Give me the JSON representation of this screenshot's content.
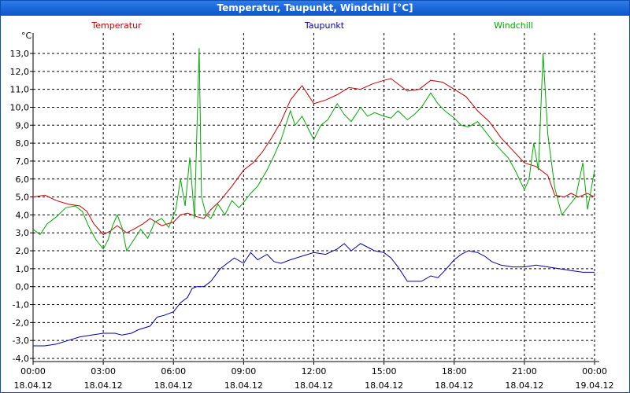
{
  "window": {
    "title": "Temperatur, Taupunkt, Windchill [°C]"
  },
  "chart_data": {
    "type": "line",
    "title": "Temperatur, Taupunkt, Windchill [°C]",
    "ylabel": "°C",
    "ylim": [
      -4.0,
      14.0
    ],
    "yticks": [
      "13,0",
      "12,0",
      "11,0",
      "10,0",
      "9,0",
      "8,0",
      "7,0",
      "6,0",
      "5,0",
      "4,0",
      "3,0",
      "2,0",
      "1,0",
      "0,0",
      "-1,0",
      "-2,0",
      "-3,0",
      "-4,0"
    ],
    "ytick_values": [
      13,
      12,
      11,
      10,
      9,
      8,
      7,
      6,
      5,
      4,
      3,
      2,
      1,
      0,
      -1,
      -2,
      -3,
      -4
    ],
    "xlim": [
      0,
      24
    ],
    "xticks": [
      {
        "time": "00:00",
        "date": "18.04.12",
        "hour": 0
      },
      {
        "time": "03:00",
        "date": "18.04.12",
        "hour": 3
      },
      {
        "time": "06:00",
        "date": "18.04.12",
        "hour": 6
      },
      {
        "time": "09:00",
        "date": "18.04.12",
        "hour": 9
      },
      {
        "time": "12:00",
        "date": "18.04.12",
        "hour": 12
      },
      {
        "time": "15:00",
        "date": "18.04.12",
        "hour": 15
      },
      {
        "time": "18:00",
        "date": "18.04.12",
        "hour": 18
      },
      {
        "time": "21:00",
        "date": "18.04.12",
        "hour": 21
      },
      {
        "time": "00:00",
        "date": "19.04.12",
        "hour": 24
      }
    ],
    "grid": true,
    "legend_position": "top",
    "series": [
      {
        "name": "Temperatur",
        "color": "#cc0000",
        "points": [
          [
            0,
            5.0
          ],
          [
            0.5,
            5.1
          ],
          [
            1,
            4.8
          ],
          [
            1.5,
            4.6
          ],
          [
            2,
            4.5
          ],
          [
            2.3,
            4.2
          ],
          [
            2.6,
            3.5
          ],
          [
            3,
            2.9
          ],
          [
            3.3,
            3.1
          ],
          [
            3.6,
            3.4
          ],
          [
            4,
            3.0
          ],
          [
            4.3,
            3.2
          ],
          [
            4.7,
            3.5
          ],
          [
            5,
            3.8
          ],
          [
            5.5,
            3.4
          ],
          [
            6,
            3.6
          ],
          [
            6.3,
            4.0
          ],
          [
            6.6,
            4.1
          ],
          [
            7,
            3.9
          ],
          [
            7.3,
            3.8
          ],
          [
            7.6,
            4.3
          ],
          [
            8,
            4.8
          ],
          [
            8.5,
            5.6
          ],
          [
            9,
            6.5
          ],
          [
            9.4,
            6.9
          ],
          [
            9.8,
            7.5
          ],
          [
            10.2,
            8.3
          ],
          [
            10.6,
            9.2
          ],
          [
            11,
            10.4
          ],
          [
            11.3,
            10.9
          ],
          [
            11.5,
            11.2
          ],
          [
            11.8,
            10.6
          ],
          [
            12,
            10.2
          ],
          [
            12.5,
            10.4
          ],
          [
            13,
            10.7
          ],
          [
            13.5,
            11.1
          ],
          [
            14,
            11.0
          ],
          [
            14.5,
            11.3
          ],
          [
            15,
            11.5
          ],
          [
            15.3,
            11.6
          ],
          [
            15.7,
            11.2
          ],
          [
            16,
            10.9
          ],
          [
            16.5,
            11.0
          ],
          [
            17,
            11.5
          ],
          [
            17.5,
            11.4
          ],
          [
            18,
            11.0
          ],
          [
            18.5,
            10.6
          ],
          [
            19,
            9.8
          ],
          [
            19.5,
            9.2
          ],
          [
            20,
            8.3
          ],
          [
            20.5,
            7.6
          ],
          [
            21,
            6.9
          ],
          [
            21.5,
            6.7
          ],
          [
            22,
            6.2
          ],
          [
            22.3,
            5.1
          ],
          [
            22.7,
            5.0
          ],
          [
            23,
            5.2
          ],
          [
            23.3,
            5.0
          ],
          [
            23.7,
            5.2
          ],
          [
            24,
            5.0
          ]
        ]
      },
      {
        "name": "Taupunkt",
        "color": "#0000aa",
        "points": [
          [
            0,
            -3.3
          ],
          [
            0.5,
            -3.3
          ],
          [
            1,
            -3.2
          ],
          [
            1.5,
            -3.0
          ],
          [
            2,
            -2.8
          ],
          [
            2.5,
            -2.7
          ],
          [
            3,
            -2.6
          ],
          [
            3.5,
            -2.6
          ],
          [
            3.8,
            -2.7
          ],
          [
            4.2,
            -2.6
          ],
          [
            4.5,
            -2.4
          ],
          [
            5,
            -2.2
          ],
          [
            5.3,
            -1.7
          ],
          [
            5.6,
            -1.6
          ],
          [
            6,
            -1.4
          ],
          [
            6.3,
            -0.9
          ],
          [
            6.6,
            -0.6
          ],
          [
            6.8,
            -0.1
          ],
          [
            7,
            0.0
          ],
          [
            7.3,
            0.0
          ],
          [
            7.6,
            0.3
          ],
          [
            8,
            1.0
          ],
          [
            8.3,
            1.3
          ],
          [
            8.6,
            1.6
          ],
          [
            9,
            1.3
          ],
          [
            9.3,
            1.9
          ],
          [
            9.6,
            1.5
          ],
          [
            10,
            1.8
          ],
          [
            10.3,
            1.4
          ],
          [
            10.6,
            1.3
          ],
          [
            11,
            1.5
          ],
          [
            11.5,
            1.7
          ],
          [
            12,
            1.9
          ],
          [
            12.5,
            1.8
          ],
          [
            13,
            2.1
          ],
          [
            13.3,
            2.4
          ],
          [
            13.6,
            2.0
          ],
          [
            14,
            2.4
          ],
          [
            14.3,
            2.2
          ],
          [
            14.6,
            2.0
          ],
          [
            15,
            1.9
          ],
          [
            15.3,
            1.6
          ],
          [
            15.6,
            1.1
          ],
          [
            16,
            0.3
          ],
          [
            16.3,
            0.3
          ],
          [
            16.6,
            0.3
          ],
          [
            17,
            0.6
          ],
          [
            17.3,
            0.5
          ],
          [
            17.6,
            0.9
          ],
          [
            18,
            1.5
          ],
          [
            18.3,
            1.8
          ],
          [
            18.6,
            2.0
          ],
          [
            19,
            1.9
          ],
          [
            19.3,
            1.7
          ],
          [
            19.6,
            1.4
          ],
          [
            20,
            1.2
          ],
          [
            20.5,
            1.1
          ],
          [
            21,
            1.1
          ],
          [
            21.5,
            1.2
          ],
          [
            22,
            1.1
          ],
          [
            22.5,
            1.0
          ],
          [
            23,
            0.9
          ],
          [
            23.5,
            0.8
          ],
          [
            24,
            0.8
          ]
        ]
      },
      {
        "name": "Windchill",
        "color": "#00aa00",
        "points": [
          [
            0,
            3.2
          ],
          [
            0.3,
            2.9
          ],
          [
            0.6,
            3.5
          ],
          [
            1,
            3.9
          ],
          [
            1.4,
            4.4
          ],
          [
            1.8,
            4.5
          ],
          [
            2.1,
            4.2
          ],
          [
            2.4,
            3.3
          ],
          [
            2.7,
            2.6
          ],
          [
            3,
            2.1
          ],
          [
            3.2,
            2.6
          ],
          [
            3.4,
            3.4
          ],
          [
            3.6,
            4.0
          ],
          [
            3.8,
            3.3
          ],
          [
            4,
            2.0
          ],
          [
            4.3,
            2.6
          ],
          [
            4.6,
            3.2
          ],
          [
            4.9,
            2.7
          ],
          [
            5.2,
            3.6
          ],
          [
            5.5,
            3.8
          ],
          [
            5.8,
            3.3
          ],
          [
            6.1,
            4.3
          ],
          [
            6.3,
            6.0
          ],
          [
            6.5,
            4.5
          ],
          [
            6.7,
            7.2
          ],
          [
            6.9,
            3.8
          ],
          [
            7.1,
            13.3
          ],
          [
            7.2,
            5.0
          ],
          [
            7.4,
            4.0
          ],
          [
            7.6,
            3.8
          ],
          [
            7.9,
            4.6
          ],
          [
            8.2,
            4.0
          ],
          [
            8.5,
            4.8
          ],
          [
            8.8,
            4.4
          ],
          [
            9,
            4.7
          ],
          [
            9.3,
            5.2
          ],
          [
            9.6,
            5.6
          ],
          [
            10,
            6.5
          ],
          [
            10.3,
            7.3
          ],
          [
            10.6,
            8.2
          ],
          [
            11,
            9.8
          ],
          [
            11.2,
            9.0
          ],
          [
            11.5,
            9.5
          ],
          [
            11.8,
            8.7
          ],
          [
            12,
            8.2
          ],
          [
            12.3,
            9.0
          ],
          [
            12.6,
            9.3
          ],
          [
            13,
            10.2
          ],
          [
            13.3,
            9.6
          ],
          [
            13.6,
            9.2
          ],
          [
            14,
            10.0
          ],
          [
            14.3,
            9.5
          ],
          [
            14.6,
            9.7
          ],
          [
            15,
            9.5
          ],
          [
            15.3,
            9.4
          ],
          [
            15.6,
            9.8
          ],
          [
            16,
            9.3
          ],
          [
            16.3,
            9.6
          ],
          [
            16.6,
            10.0
          ],
          [
            17,
            10.8
          ],
          [
            17.3,
            10.2
          ],
          [
            17.6,
            9.8
          ],
          [
            18,
            9.4
          ],
          [
            18.3,
            9.0
          ],
          [
            18.6,
            8.9
          ],
          [
            19,
            9.2
          ],
          [
            19.3,
            8.7
          ],
          [
            19.6,
            8.2
          ],
          [
            20,
            7.6
          ],
          [
            20.3,
            7.2
          ],
          [
            20.6,
            6.5
          ],
          [
            21,
            5.4
          ],
          [
            21.2,
            6.0
          ],
          [
            21.4,
            8.0
          ],
          [
            21.6,
            6.5
          ],
          [
            21.8,
            13.0
          ],
          [
            22,
            8.5
          ],
          [
            22.3,
            5.5
          ],
          [
            22.6,
            4.0
          ],
          [
            22.9,
            4.5
          ],
          [
            23.2,
            5.0
          ],
          [
            23.5,
            6.9
          ],
          [
            23.7,
            4.3
          ],
          [
            24,
            6.5
          ]
        ]
      }
    ]
  }
}
